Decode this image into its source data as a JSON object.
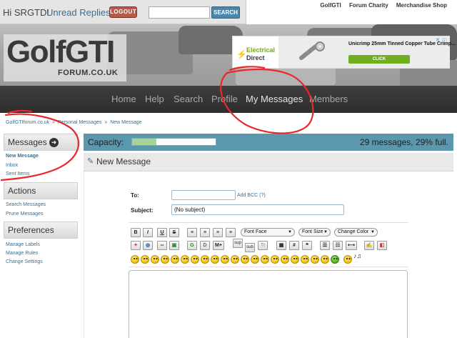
{
  "top": {
    "greeting": "Hi SRGTD!",
    "unread_replies": "Unread Replies",
    "logout_label": "LOGOUT",
    "search_button": "SEARCH",
    "search_value": "",
    "links": [
      "GolfGTI",
      "Forum Charity",
      "Merchandise Shop"
    ]
  },
  "logo": {
    "main": "GolfGTI",
    "sub": "FORUM.CO.UK"
  },
  "ad": {
    "brand_line1": "Electrical",
    "brand_line2": "Direct",
    "title": "Unicrimp 25mm Tinned Copper Tube Crimp...",
    "cta": "CLICK"
  },
  "nav": [
    "Home",
    "Help",
    "Search",
    "Profile",
    "My Messages",
    "Members"
  ],
  "breadcrumb": [
    "GolfGTIforum.co.uk",
    "Personal Messages",
    "New Message"
  ],
  "breadcrumb_sep": "»",
  "sidebar": {
    "messages_title": "Messages",
    "messages_links": [
      "New Message",
      "Inbox",
      "Sent Items"
    ],
    "actions_title": "Actions",
    "actions_links": [
      "Search Messages",
      "Prune Messages"
    ],
    "prefs_title": "Preferences",
    "prefs_links": [
      "Manage Labels",
      "Manage Rules",
      "Change Settings"
    ]
  },
  "capacity": {
    "label": "Capacity:",
    "status": "29 messages, 29% full.",
    "fraction": 0.29
  },
  "compose": {
    "title": "New Message",
    "to_label": "To:",
    "to_value": "",
    "add_bcc": "Add BCC (?)",
    "subject_label": "Subject:",
    "subject_value": "(No subject)"
  },
  "toolbar": {
    "bold": "B",
    "italic": "I",
    "underline": "U",
    "strike": "S",
    "font_face": "Font Face",
    "font_size": "Font Size",
    "change_color": "Change Color",
    "glow": "G",
    "shadow": "D",
    "move": "M+",
    "sup": "sup",
    "sub": "sub",
    "tt": "Tt",
    "hash": "#"
  },
  "colors": {
    "nav_bg": "#2d2d2d",
    "capacity_bg": "#5b97ad",
    "capacity_fill": "#a6d39b",
    "link": "#3a6f8f",
    "logout": "#b85a4a",
    "scribble": "#e8282b"
  }
}
